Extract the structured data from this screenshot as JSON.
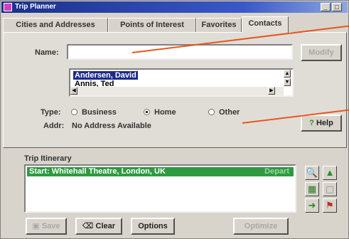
{
  "window": {
    "title": "Trip Planner",
    "controls": [
      "_",
      "□"
    ]
  },
  "tabs": [
    {
      "label": "Cities and Addresses",
      "active": false
    },
    {
      "label": "Points of Interest",
      "active": false
    },
    {
      "label": "Favorites",
      "active": false
    },
    {
      "label": "Contacts",
      "active": true
    }
  ],
  "contacts": {
    "name_label": "Name:",
    "name_value": "",
    "modify_label": "Modify",
    "list": [
      {
        "label": "Andersen, David",
        "selected": true
      },
      {
        "label": "Annis, Ted",
        "selected": false
      }
    ],
    "type_label": "Type:",
    "types": [
      {
        "label": "Business",
        "checked": false
      },
      {
        "label": "Home",
        "checked": true
      },
      {
        "label": "Other",
        "checked": false
      }
    ],
    "addr_label": "Addr:",
    "addr_value": "No Address Available",
    "help_label": "Help",
    "help_icon": "question-mark-icon"
  },
  "itinerary": {
    "title": "Trip Itinerary",
    "rows": [
      {
        "text": "Start: Whitehall Theatre, London, UK",
        "status": "Depart"
      }
    ],
    "tools": [
      "magnify-icon",
      "arrow-up-icon",
      "map-icon",
      "page-icon",
      "arrow-right-icon",
      "flag-icon"
    ]
  },
  "bottom": {
    "save_label": "Save",
    "clear_label": "Clear",
    "clear_icon": "clear-icon",
    "options_label": "Options",
    "optimize_label": "Optimize"
  },
  "colors": {
    "accent_selection": "#1d2a8c",
    "itinerary_highlight": "#2e9a40",
    "callout": "#e8561e"
  }
}
